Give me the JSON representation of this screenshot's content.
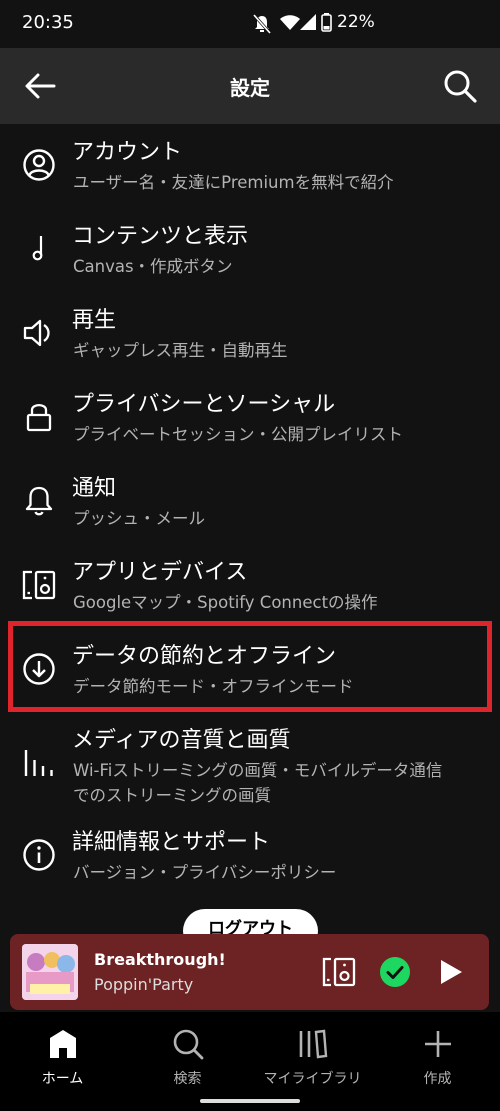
{
  "status_bar": {
    "time": "20:35",
    "battery": "22%",
    "icons": [
      "bell-off-icon",
      "wifi-icon",
      "signal-icon",
      "battery-icon"
    ]
  },
  "header": {
    "title": "設定",
    "back_icon": "arrow-left-icon",
    "search_icon": "search-icon"
  },
  "settings": [
    {
      "icon": "account-icon",
      "title": "アカウント",
      "sub1": "ユーザー名・友達にPremiumを無料で紹介"
    },
    {
      "icon": "music-note-icon",
      "title": "コンテンツと表示",
      "sub1": "Canvas・作成ボタン"
    },
    {
      "icon": "speaker-icon",
      "title": "再生",
      "sub1": "ギャップレス再生・自動再生"
    },
    {
      "icon": "lock-icon",
      "title": "プライバシーとソーシャル",
      "sub1": "プライベートセッション・公開プレイリスト"
    },
    {
      "icon": "bell-icon",
      "title": "通知",
      "sub1": "プッシュ・メール"
    },
    {
      "icon": "devices-icon",
      "title": "アプリとデバイス",
      "sub1": "Googleマップ・Spotify Connectの操作"
    },
    {
      "icon": "download-circle-icon",
      "title": "データの節約とオフライン",
      "sub1": "データ節約モード・オフラインモード"
    },
    {
      "icon": "equalizer-icon",
      "title": "メディアの音質と画質",
      "sub1": "Wi-Fiストリーミングの画質・モバイルデータ通信",
      "sub2": "でのストリーミングの画質"
    },
    {
      "icon": "info-icon",
      "title": "詳細情報とサポート",
      "sub1": "バージョン・プライバシーポリシー"
    }
  ],
  "logout_label": "ログアウト",
  "player": {
    "title": "Breakthrough!",
    "artist": "Poppin'Party",
    "device_icon": "device-connect-icon",
    "saved_icon": "check-circle-icon",
    "play_icon": "play-icon",
    "accent": "#1ed760",
    "bg": "#6d2323"
  },
  "nav": [
    {
      "icon": "home-icon",
      "label": "ホーム",
      "active": true
    },
    {
      "icon": "search-icon",
      "label": "検索",
      "active": false
    },
    {
      "icon": "library-icon",
      "label": "マイライブラリ",
      "active": false
    },
    {
      "icon": "plus-icon",
      "label": "作成",
      "active": false
    }
  ],
  "highlight_color": "#e0242c"
}
